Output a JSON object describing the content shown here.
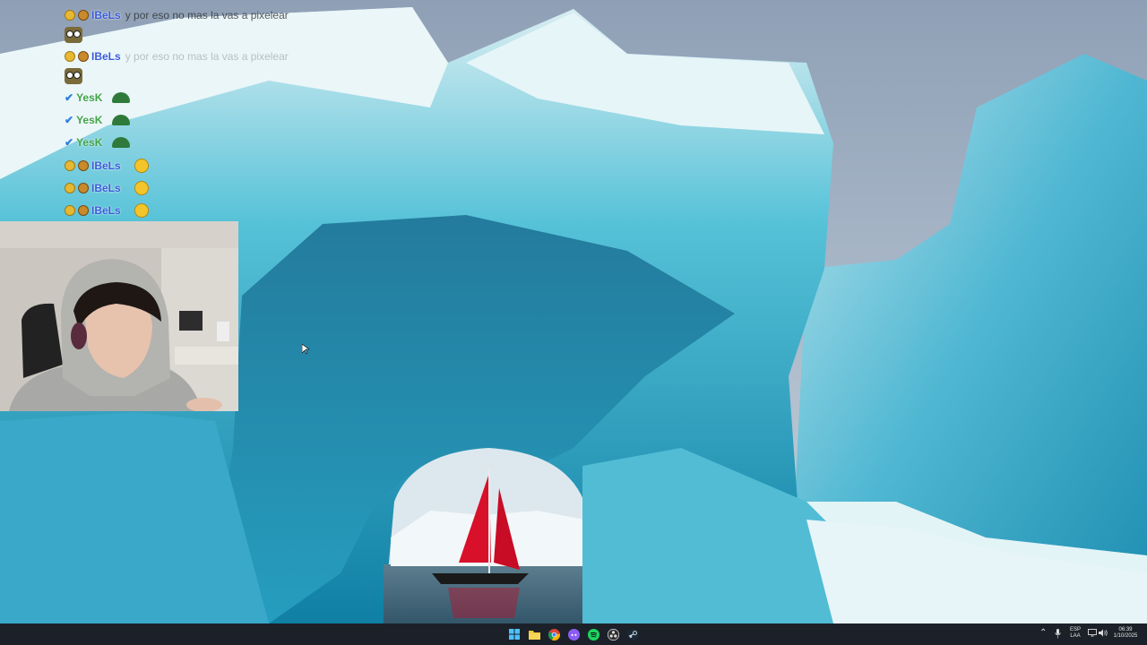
{
  "chat": {
    "messages": [
      {
        "user": "IBeLs",
        "text": "y por eso no mas la vas a pixelear"
      },
      {
        "user": "IBeLs",
        "text": "y por eso no mas la vas a pixelear"
      },
      {
        "user": "YesK"
      },
      {
        "user": "YesK"
      },
      {
        "user": "YesK"
      },
      {
        "user": "IBeLs"
      },
      {
        "user": "IBeLs"
      },
      {
        "user": "IBeLs"
      }
    ]
  },
  "taskbar": {
    "apps": [
      "start",
      "file-explorer",
      "chrome",
      "discord",
      "spotify",
      "obs",
      "steam"
    ],
    "language": "ESP",
    "layout": "LAA",
    "time": "06:39",
    "date": "1/10/2025"
  },
  "colors": {
    "taskbar_bg": "#1c2129",
    "username_ibels": "#3b5cd9",
    "username_yesk": "#3fa447",
    "sail": "#d8102a"
  }
}
